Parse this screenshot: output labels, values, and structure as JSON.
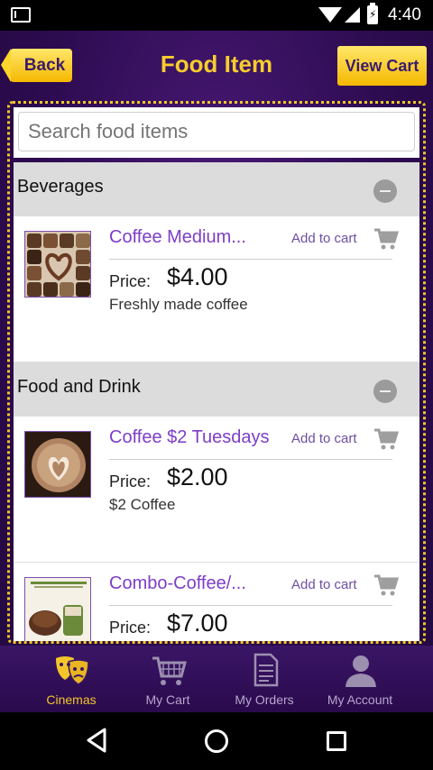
{
  "status_bar": {
    "time": "4:40"
  },
  "header": {
    "back_label": "Back",
    "title": "Food Item",
    "view_cart_label": "View Cart"
  },
  "search": {
    "placeholder": "Search food items"
  },
  "sections": [
    {
      "title": "Beverages",
      "items": [
        {
          "name": "Coffee Medium...",
          "add_to_cart": "Add to cart",
          "price_label": "Price:",
          "price": "$4.00",
          "description": "Freshly made coffee"
        }
      ]
    },
    {
      "title": "Food and Drink",
      "items": [
        {
          "name": "Coffee $2 Tuesdays",
          "add_to_cart": "Add to cart",
          "price_label": "Price:",
          "price": "$2.00",
          "description": "$2 Coffee"
        },
        {
          "name": "Combo-Coffee/...",
          "add_to_cart": "Add to cart",
          "price_label": "Price:",
          "price": "$7.00",
          "description": ""
        }
      ]
    }
  ],
  "bottom_nav": [
    {
      "label": "Cinemas",
      "icon": "theater-masks-icon",
      "active": true
    },
    {
      "label": "My Cart",
      "icon": "cart-icon",
      "active": false
    },
    {
      "label": "My Orders",
      "icon": "document-icon",
      "active": false
    },
    {
      "label": "My Account",
      "icon": "person-icon",
      "active": false
    }
  ],
  "colors": {
    "accent_yellow": "#f2c62a",
    "brand_purple": "#2c0b4f",
    "item_name_purple": "#7e3ec8"
  }
}
